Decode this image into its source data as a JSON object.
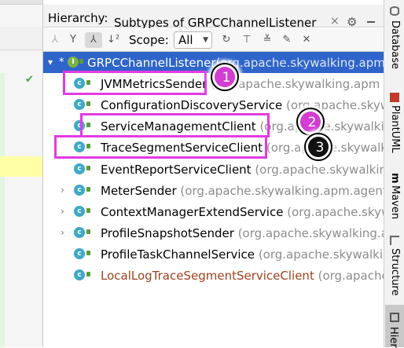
{
  "panel": {
    "title": "Hierarchy:",
    "tab_label": "Subtypes of GRPCChannelListener",
    "tab_close": "×"
  },
  "toolbar": {
    "scope_label": "Scope:",
    "scope_value": "All",
    "buttons": [
      "type-hierarchy",
      "supertypes-hierarchy",
      "subtypes-hierarchy",
      "sort-alphabetically",
      "refresh",
      "autoscroll",
      "expand-all",
      "pin-tab",
      "close"
    ]
  },
  "tree": {
    "root": {
      "name": "GRPCChannelListener",
      "package": "(org.apache.skywalking.apm"
    },
    "items": [
      {
        "name": "JVMMetricsSender",
        "package": " (org.apache.skywalking.apm",
        "expandable": false,
        "brown": false
      },
      {
        "name": "ConfigurationDiscoveryService",
        "package": " (org.apache.skywalking",
        "expandable": false,
        "brown": false
      },
      {
        "name": "ServiceManagementClient",
        "package": " (org.apache.skywalking",
        "expandable": false,
        "brown": false
      },
      {
        "name": "TraceSegmentServiceClient",
        "package": " (org.apache.skywalking",
        "expandable": false,
        "brown": false
      },
      {
        "name": "EventReportServiceClient",
        "package": " (org.apache.skywalking",
        "expandable": false,
        "brown": false
      },
      {
        "name": "MeterSender",
        "package": " (org.apache.skywalking.apm.agent",
        "expandable": true,
        "brown": false
      },
      {
        "name": "ContextManagerExtendService",
        "package": " (org.apache.skywalking",
        "expandable": true,
        "brown": false
      },
      {
        "name": "ProfileSnapshotSender",
        "package": " (org.apache.skywalking.apm",
        "expandable": true,
        "brown": false
      },
      {
        "name": "ProfileTaskChannelService",
        "package": " (org.apache.skywalking",
        "expandable": false,
        "brown": false
      },
      {
        "name": "LocalLogTraceSegmentServiceClient",
        "package": " (org.apache",
        "expandable": false,
        "brown": true
      }
    ]
  },
  "badges": [
    "1",
    "2",
    "3"
  ],
  "side_tabs": [
    "Database",
    "PlantUML",
    "Maven",
    "Structure",
    "Hier"
  ],
  "colors": {
    "selection": "#2f65ca",
    "highlight": "#e23be2",
    "badge": "#d23dd2"
  }
}
